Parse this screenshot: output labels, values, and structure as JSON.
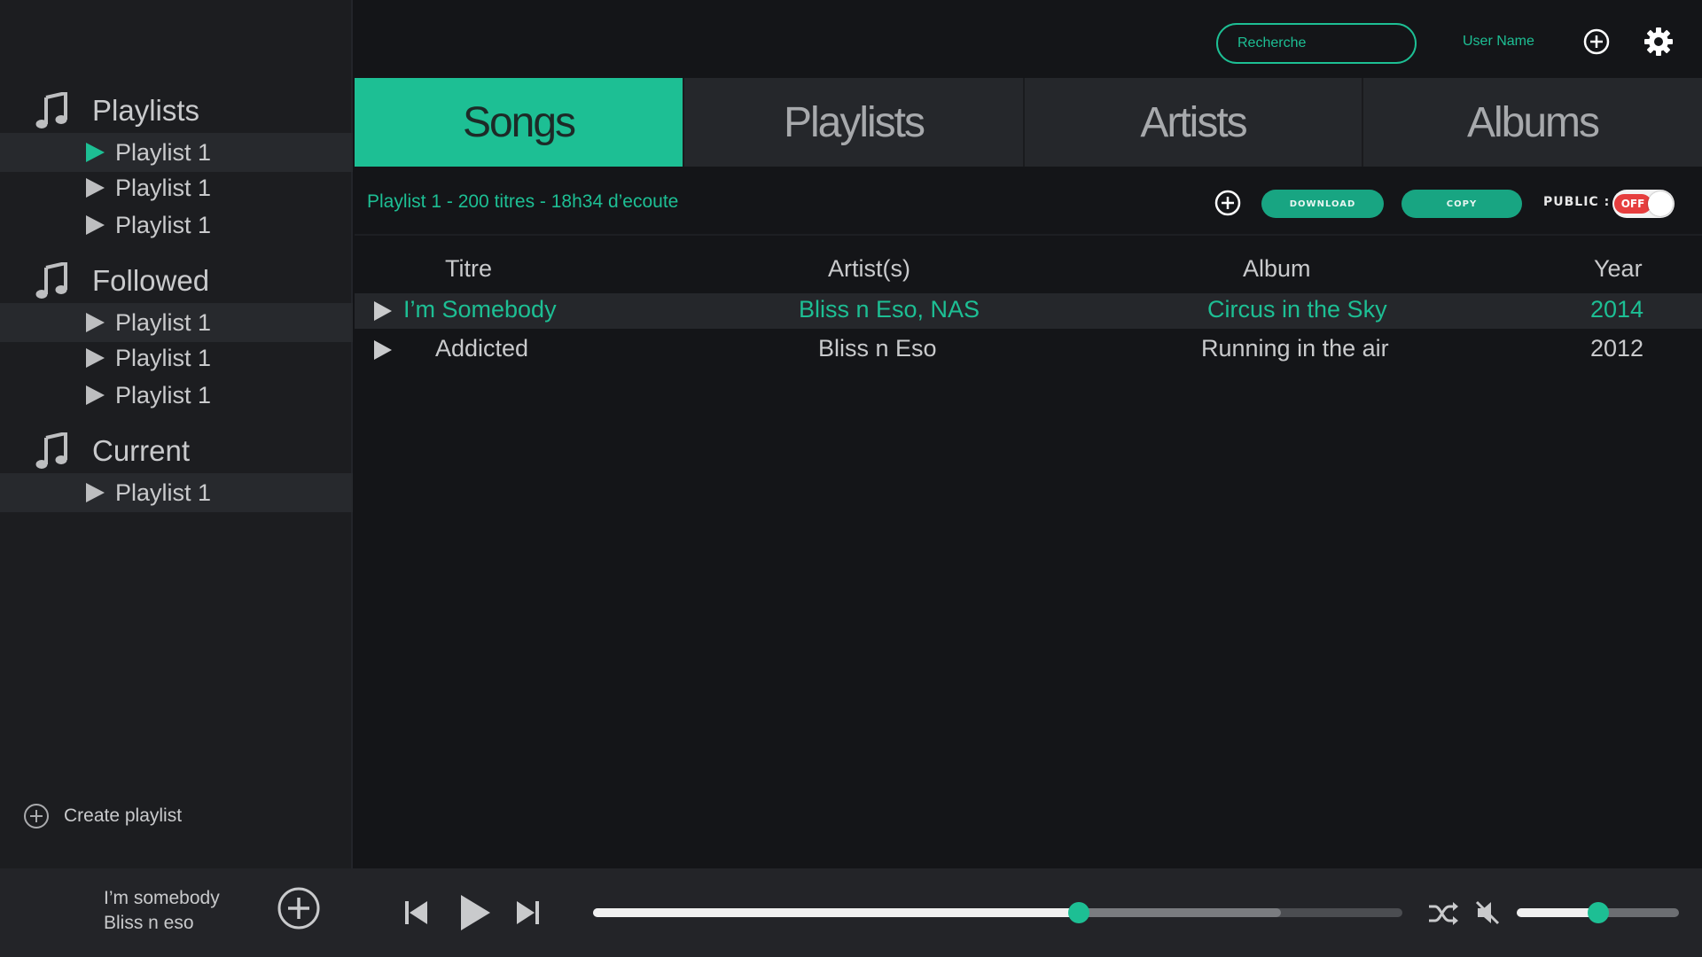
{
  "colors": {
    "accent": "#1dbf94",
    "toggle_off": "#e63e3e"
  },
  "header": {
    "search_placeholder": "Recherche",
    "username": "User Name",
    "add_icon": "plus-circle-icon",
    "settings_icon": "gear-icon"
  },
  "sidebar": {
    "sections": [
      {
        "title": "Playlists",
        "icon": "music-note-icon",
        "items": [
          "Playlist 1",
          "Playlist 1",
          "Playlist 1"
        ]
      },
      {
        "title": "Followed",
        "icon": "music-note-icon",
        "items": [
          "Playlist 1",
          "Playlist 1",
          "Playlist 1"
        ]
      },
      {
        "title": "Current",
        "icon": "music-note-icon",
        "items": [
          "Playlist 1"
        ]
      }
    ],
    "create_label": "Create playlist"
  },
  "tabs": [
    "Songs",
    "Playlists",
    "Artists",
    "Albums"
  ],
  "active_tab": "Songs",
  "playlist_bar": {
    "title": "Playlist 1 - 200 titres - 18h34 d’ecoute",
    "download_label": "DOWNLOAD",
    "copy_label": "COPY",
    "public_label": "PUBLIC :",
    "public_state": "OFF"
  },
  "table": {
    "columns": [
      "Titre",
      "Artist(s)",
      "Album",
      "Year"
    ],
    "rows": [
      {
        "title": "I’m Somebody",
        "artist": "Bliss n Eso, NAS",
        "album": "Circus in the Sky",
        "year": "2014",
        "playing": true
      },
      {
        "title": "Addicted",
        "artist": "Bliss n Eso",
        "album": "Running in the air",
        "year": "2012",
        "playing": false
      }
    ]
  },
  "player": {
    "track": "I’m somebody",
    "artist": "Bliss n eso",
    "progress": 0.6,
    "buffered": 0.85,
    "volume": 0.5
  }
}
